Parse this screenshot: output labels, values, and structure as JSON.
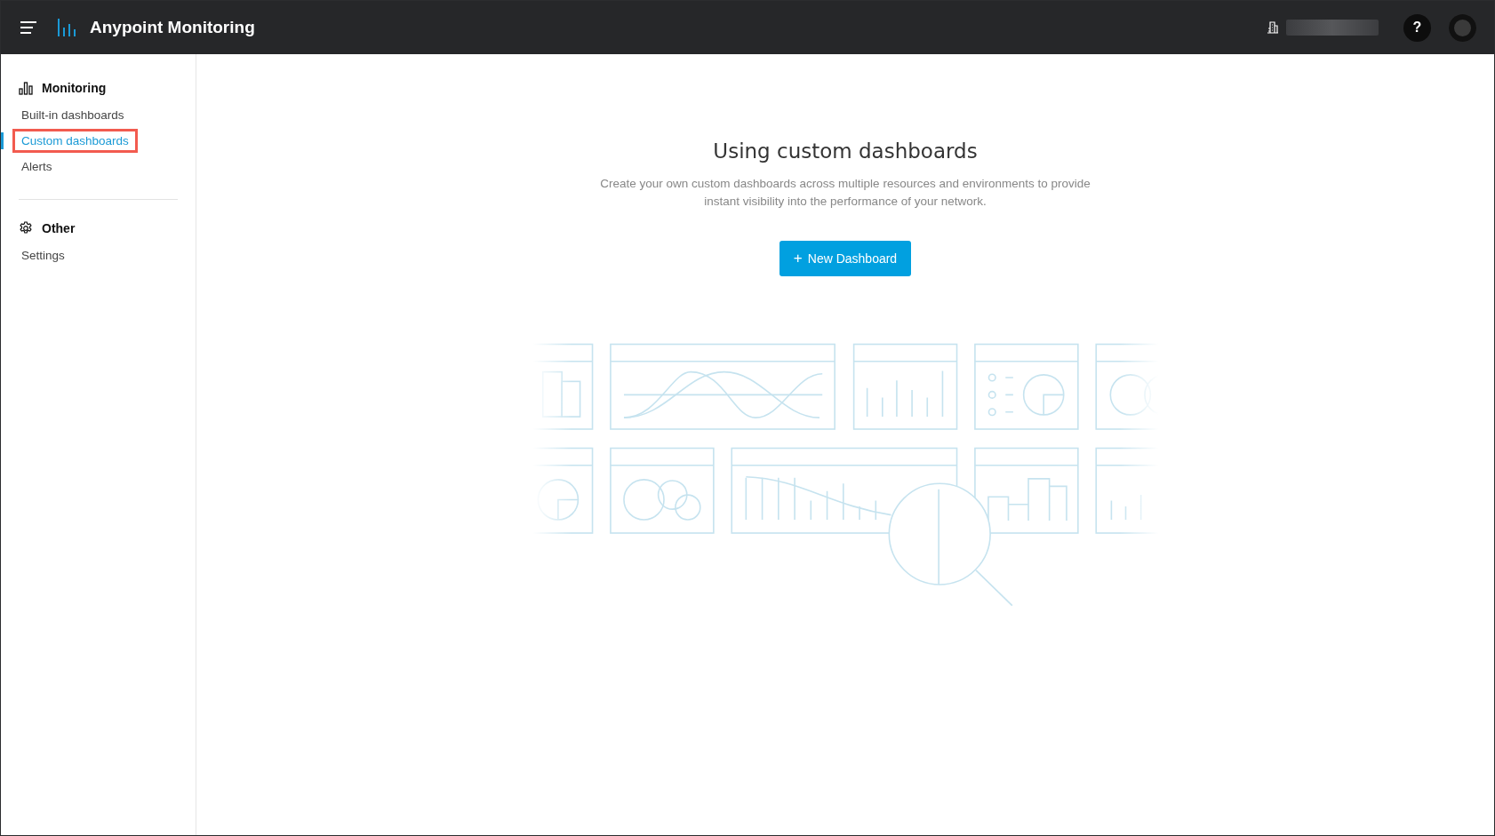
{
  "app_bar": {
    "title": "Anypoint Monitoring",
    "help_label": "?"
  },
  "sidebar": {
    "sections": [
      {
        "kind": "chart",
        "heading": "Monitoring",
        "items": [
          {
            "label": "Built-in dashboards",
            "selected": false,
            "highlighted": false
          },
          {
            "label": "Custom dashboards",
            "selected": true,
            "highlighted": true
          },
          {
            "label": "Alerts",
            "selected": false,
            "highlighted": false
          }
        ]
      },
      {
        "kind": "gear",
        "heading": "Other",
        "items": [
          {
            "label": "Settings",
            "selected": false,
            "highlighted": false
          }
        ]
      }
    ]
  },
  "empty_state": {
    "title": "Using custom dashboards",
    "description": "Create your own custom dashboards across multiple resources and environments to provide instant visibility into the performance of your network.",
    "button": {
      "icon": "+",
      "label": "New Dashboard"
    }
  }
}
